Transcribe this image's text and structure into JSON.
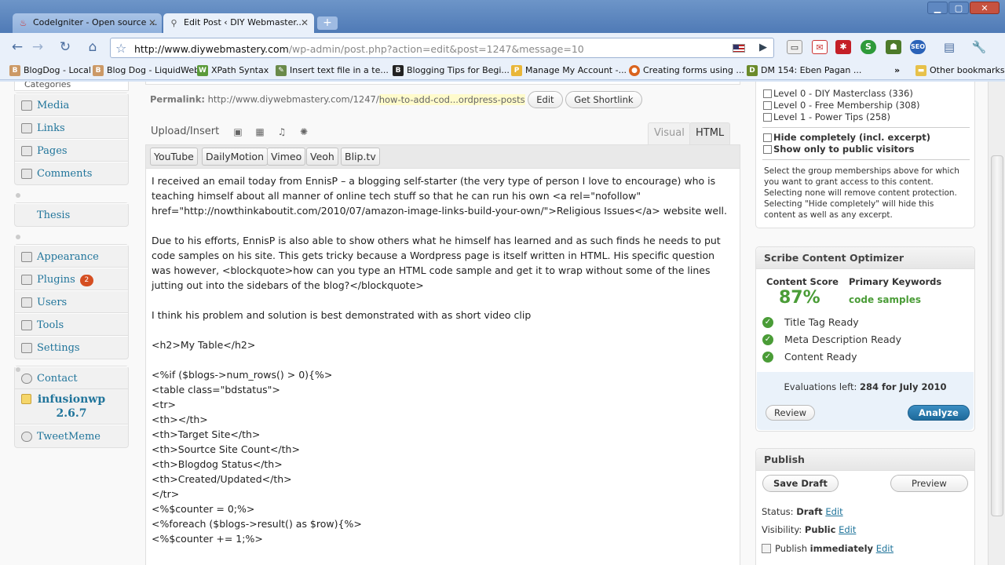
{
  "browser": {
    "tabs": [
      {
        "title": "CodeIgniter - Open source ...",
        "active": false
      },
      {
        "title": "Edit Post ‹ DIY Webmaster...",
        "active": true
      }
    ],
    "url_host": "http://www.diywebmastery.com",
    "url_path": "/wp-admin/post.php?action=edit&post=1247&message=10",
    "bookmarks": [
      "BlogDog - Local",
      "Blog Dog - LiquidWeb",
      "XPath Syntax",
      "Insert text file in a te...",
      "Blogging Tips for Begi...",
      "Manage My Account -...",
      "Creating forms using ...",
      "DM 154: Eben Pagan ...",
      "Other bookmarks"
    ],
    "bookmark_overflow": "»"
  },
  "menu": {
    "categories_label": "Categories",
    "group1": [
      "Media",
      "Links",
      "Pages",
      "Comments"
    ],
    "thesis": "Thesis",
    "group2": [
      "Appearance",
      "Plugins",
      "Users",
      "Tools",
      "Settings"
    ],
    "plugins_badge": "2",
    "contact": "Contact",
    "infusion_line1": "infusionwp",
    "infusion_line2": "2.6.7",
    "tweetmeme": "TweetMeme"
  },
  "editor": {
    "permalink_label": "Permalink:",
    "permalink_base": "http://www.diywebmastery.com/1247/",
    "permalink_slug": "how-to-add-cod...ordpress-posts",
    "edit_button": "Edit",
    "shortlink_button": "Get Shortlink",
    "upload_insert": "Upload/Insert",
    "tab_visual": "Visual",
    "tab_html": "HTML",
    "quicktags": [
      "YouTube",
      "DailyMotion",
      "Vimeo",
      "Veoh",
      "Blip.tv"
    ],
    "content": [
      "I received an email today from EnnisP – a blogging self-starter (the very type of person I love to encourage) who is teaching himself about all manner of online tech stuff so that he can run his own <a rel=\"nofollow\" href=\"http://nowthinkaboutit.com/2010/07/amazon-image-links-build-your-own/\">Religious Issues</a> website well.",
      "",
      "Due to his efforts, EnnisP is also able to show others what he himself has learned and as such finds he needs to put code samples on his site. This gets tricky because a Wordpress page is itself written in HTML. His specific question was however, <blockquote>how can you type an HTML code sample and get it to wrap without some of the lines jutting out into the sidebars of the blog?</blockquote>",
      "",
      "I think his problem and solution is best demonstrated with as short video clip",
      "",
      "<h2>My Table</h2>",
      "",
      "<%if ($blogs->num_rows() > 0){%>",
      "<table class=\"bdstatus\">",
      "<tr>",
      "<th></th>",
      "<th>Target Site</th>",
      "<th>Sourtce Site Count</th>",
      "<th>Blogdog Status</th>",
      "<th>Created/Updated</th>",
      "</tr>",
      "<%$counter = 0;%>",
      "<%foreach ($blogs->result() as $row){%>",
      "<%$counter += 1;%>"
    ]
  },
  "memberships": {
    "levels": [
      "Level 0 - DIY Masterclass (336)",
      "Level 0 - Free Membership (308)",
      "Level 1 - Power Tips (258)"
    ],
    "hide_completely": "Hide completely (incl. excerpt)",
    "show_public": "Show only to public visitors",
    "note": "Select the group memberships above for which you want to grant access to this content. Selecting none will remove content protection. Selecting \"Hide completely\" will hide this content as well as any excerpt."
  },
  "scribe": {
    "title": "Scribe Content Optimizer",
    "score_label": "Content Score",
    "score_value": "87%",
    "keywords_label": "Primary Keywords",
    "keywords_value": "code samples",
    "checks": [
      "Title Tag Ready",
      "Meta Description Ready",
      "Content Ready"
    ],
    "evaluations_text": "Evaluations left:",
    "evaluations_value": "284 for July 2010",
    "review_button": "Review",
    "analyze_button": "Analyze",
    "score_color": "#4a9c37"
  },
  "publish": {
    "title": "Publish",
    "save_draft": "Save Draft",
    "preview": "Preview",
    "status_label": "Status:",
    "status_value": "Draft",
    "visibility_label": "Visibility:",
    "visibility_value": "Public",
    "publish_label": "Publish",
    "publish_value": "immediately",
    "edit_link": "Edit"
  }
}
